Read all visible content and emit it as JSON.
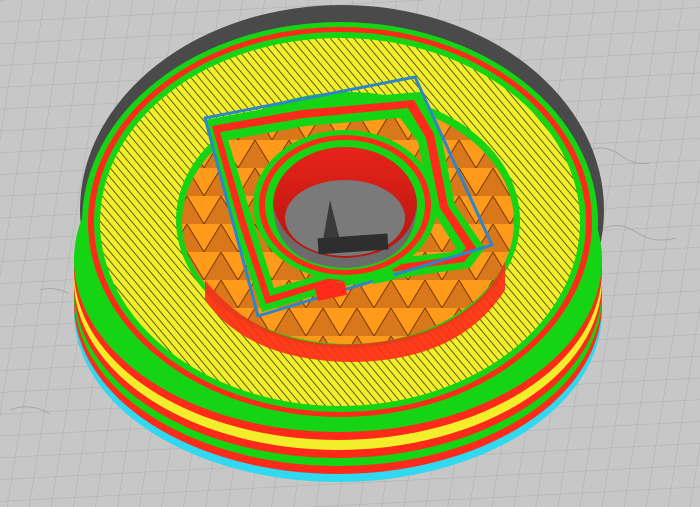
{
  "app": {
    "view": "slicer-layer-preview",
    "camera": "perspective"
  },
  "scene": {
    "bed": {
      "color": "#c6c6c6",
      "grid_color": "#b0b0b0",
      "grid": true
    },
    "object": {
      "shape": "flanged-pulley-disc",
      "preview_layer_feature": "square-hub-outline",
      "colors": {
        "outer_wall": "#ff2a1a",
        "inner_wall": "#14d414",
        "top_infill": "#f2ef2a",
        "sparse_infill": "#ff9a1a",
        "support_skirt": "#30d8f0",
        "shadow_side": "#555555",
        "travel_outline": "#2c86c8",
        "bore_shadow": "#6b6b6b"
      }
    }
  }
}
